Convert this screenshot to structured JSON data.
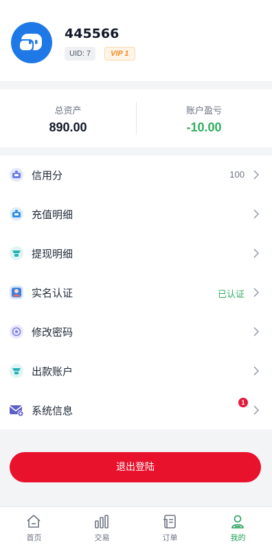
{
  "profile": {
    "username": "445566",
    "uid": "UID: 7",
    "vip": "VIP 1",
    "avatar_icon": "robot-avatar-icon"
  },
  "assets": {
    "total_label": "总资产",
    "total_value": "890.00",
    "pnl_label": "账户盈亏",
    "pnl_value": "-10.00"
  },
  "menu": [
    {
      "label": "信用分",
      "value": "100",
      "icon": "credit-icon"
    },
    {
      "label": "充值明细",
      "value": "",
      "icon": "deposit-icon"
    },
    {
      "label": "提现明细",
      "value": "",
      "icon": "withdraw-icon"
    },
    {
      "label": "实名认证",
      "value": "已认证",
      "icon": "id-card-icon"
    },
    {
      "label": "修改密码",
      "value": "",
      "icon": "lock-icon"
    },
    {
      "label": "出款账户",
      "value": "",
      "icon": "account-icon"
    },
    {
      "label": "系统信息",
      "value": "",
      "icon": "mail-icon",
      "badge": "1"
    }
  ],
  "logout_label": "退出登陆",
  "tabs": [
    {
      "label": "首页",
      "icon": "home-icon",
      "active": false
    },
    {
      "label": "交易",
      "icon": "chart-icon",
      "active": false
    },
    {
      "label": "订单",
      "icon": "order-icon",
      "active": false
    },
    {
      "label": "我的",
      "icon": "user-icon",
      "active": true
    }
  ],
  "colors": {
    "accent_green": "#2fae5f",
    "logout_red": "#e8122d",
    "avatar_blue": "#1e78e6"
  }
}
